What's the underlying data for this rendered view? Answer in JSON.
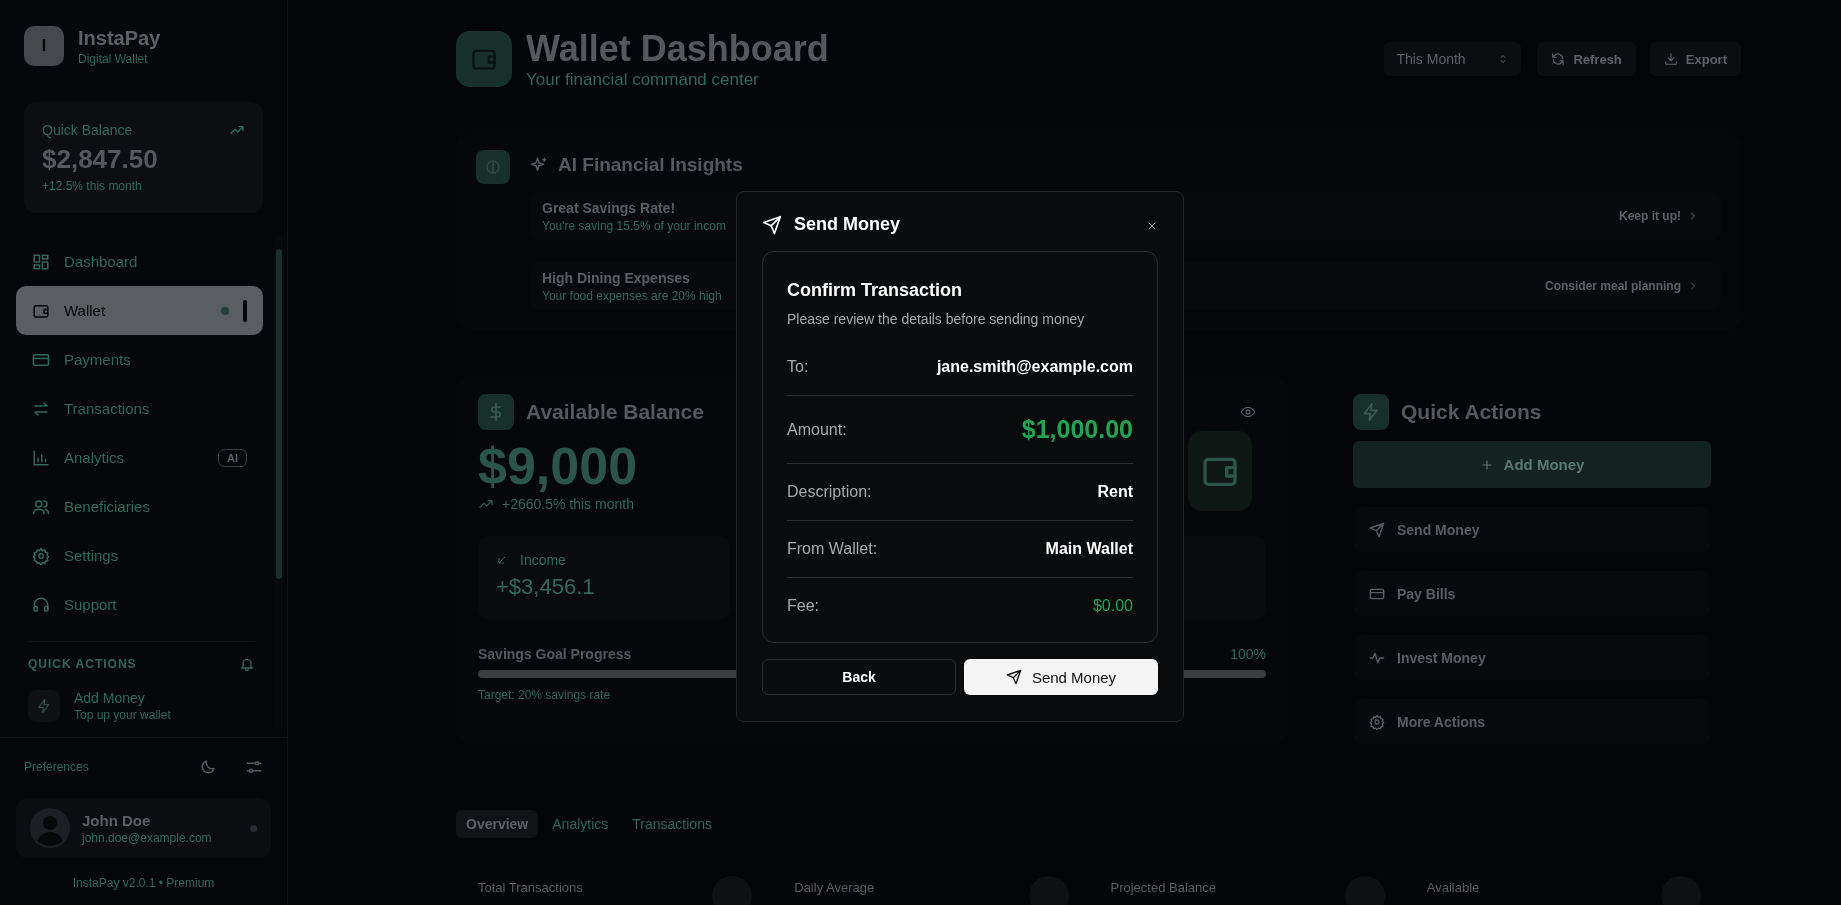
{
  "sidebar": {
    "logo": {
      "letter": "I",
      "name": "InstaPay",
      "tagline": "Digital Wallet"
    },
    "quick_balance": {
      "label": "Quick Balance",
      "amount": "$2,847.50",
      "change": "+12.5% this month"
    },
    "nav": [
      {
        "label": "Dashboard",
        "selected": false
      },
      {
        "label": "Wallet",
        "selected": true
      },
      {
        "label": "Payments",
        "selected": false
      },
      {
        "label": "Transactions",
        "selected": false
      },
      {
        "label": "Analytics",
        "selected": false,
        "badge": "AI"
      },
      {
        "label": "Beneficiaries",
        "selected": false
      },
      {
        "label": "Settings",
        "selected": false
      },
      {
        "label": "Support",
        "selected": false
      }
    ],
    "quick_actions_label": "QUICK ACTIONS",
    "quick_action": {
      "title": "Add Money",
      "subtitle": "Top up your wallet"
    },
    "preferences_label": "Preferences",
    "user": {
      "name": "John Doe",
      "email": "john.doe@example.com"
    },
    "version": "InstaPay v2.0.1 • Premium"
  },
  "header": {
    "title": "Wallet Dashboard",
    "subtitle": "Your financial command center",
    "period": "This Month",
    "buttons": [
      "Refresh",
      "Export"
    ]
  },
  "insights": {
    "title": "AI Financial Insights",
    "items": [
      {
        "title": "Great Savings Rate!",
        "text": "You're saving 15.5% of your incom",
        "action": "Keep it up!"
      },
      {
        "title": "High Dining Expenses",
        "text": "Your food expenses are 20% high",
        "action": "Consider meal planning"
      }
    ]
  },
  "balance": {
    "title": "Available Balance",
    "amount": "$9,000",
    "change": "+2660.5% this month",
    "income": {
      "label": "Income",
      "amount": "+$3,456.1"
    },
    "savings": {
      "label": "Savings Goal Progress",
      "percent": "100%",
      "level": 1.0,
      "target": "Target: 20% savings rate"
    }
  },
  "quick_actions": {
    "title": "Quick Actions",
    "primary": "Add Money",
    "items": [
      "Send Money",
      "Pay Bills",
      "Invest Money",
      "More Actions"
    ]
  },
  "tabs": [
    {
      "label": "Overview",
      "selected": true
    },
    {
      "label": "Analytics",
      "selected": false
    },
    {
      "label": "Transactions",
      "selected": false
    }
  ],
  "stats": [
    "Total Transactions",
    "Daily Average",
    "Projected Balance",
    "Available"
  ],
  "modal": {
    "title": "Send Money",
    "heading": "Confirm Transaction",
    "subheading": "Please review the details before sending money",
    "rows": [
      {
        "label": "To:",
        "value": "jane.smith@example.com",
        "kind": "text"
      },
      {
        "label": "Amount:",
        "value": "$1,000.00",
        "kind": "amount"
      },
      {
        "label": "Description:",
        "value": "Rent",
        "kind": "text"
      },
      {
        "label": "From Wallet:",
        "value": "Main Wallet",
        "kind": "text"
      },
      {
        "label": "Fee:",
        "value": "$0.00",
        "kind": "positive"
      }
    ],
    "back": "Back",
    "confirm": "Send Money"
  }
}
